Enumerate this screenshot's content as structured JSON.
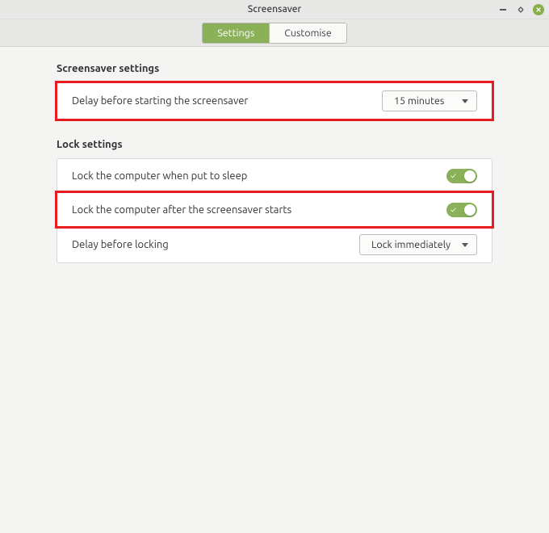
{
  "window": {
    "title": "Screensaver"
  },
  "tabs": {
    "settings": "Settings",
    "customise": "Customise",
    "active": "settings"
  },
  "sections": {
    "screensaver": {
      "title": "Screensaver settings",
      "delay_label": "Delay before starting the screensaver",
      "delay_value": "15 minutes"
    },
    "lock": {
      "title": "Lock settings",
      "sleep_label": "Lock the computer when put to sleep",
      "sleep_on": true,
      "after_ss_label": "Lock the computer after the screensaver starts",
      "after_ss_on": true,
      "delay_label": "Delay before locking",
      "delay_value": "Lock immediately"
    }
  },
  "colors": {
    "accent": "#8bb158",
    "highlight": "#e81c1e"
  }
}
